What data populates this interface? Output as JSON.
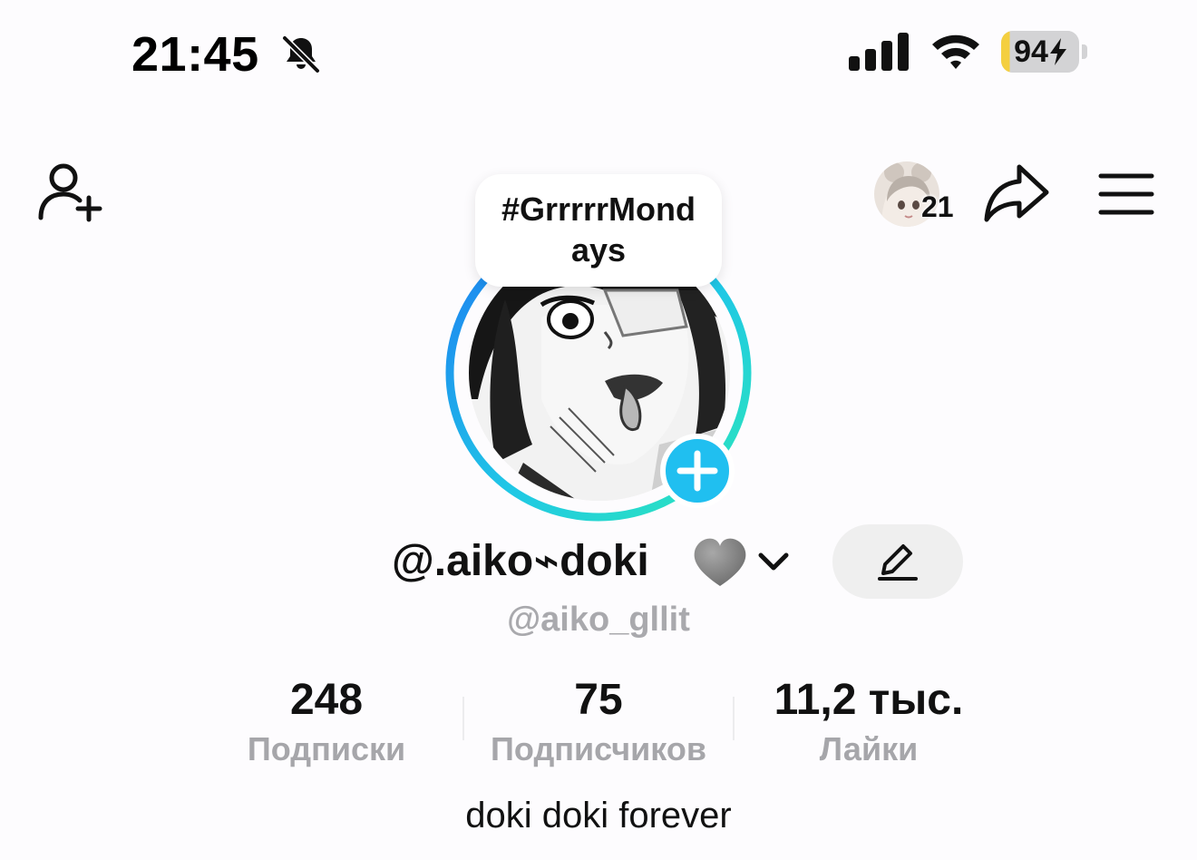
{
  "status_bar": {
    "time": "21:45",
    "battery_percent": "94",
    "battery_level": 0.94,
    "icons": [
      "bell-off-icon",
      "cellular-signal-icon",
      "wifi-icon",
      "battery-charging-icon"
    ]
  },
  "nav": {
    "icons": [
      "add-friend-icon",
      "share-icon",
      "menu-icon"
    ],
    "avatar_count": "21"
  },
  "profile": {
    "bubble_text": "#GrrrrrMondays",
    "display_name": "@.aiko⌁doki",
    "username": "@aiko_gllit",
    "bio": "doki doki forever"
  },
  "stats": [
    {
      "value": "248",
      "label": "Подписки"
    },
    {
      "value": "75",
      "label": "Подписчиков"
    },
    {
      "value": "11,2 тыс.",
      "label": "Лайки"
    }
  ],
  "colors": {
    "accent": "#22b7ea",
    "ring_start": "#1e90ff",
    "ring_end": "#2de0c2",
    "battery_fill": "#f4cf40"
  }
}
